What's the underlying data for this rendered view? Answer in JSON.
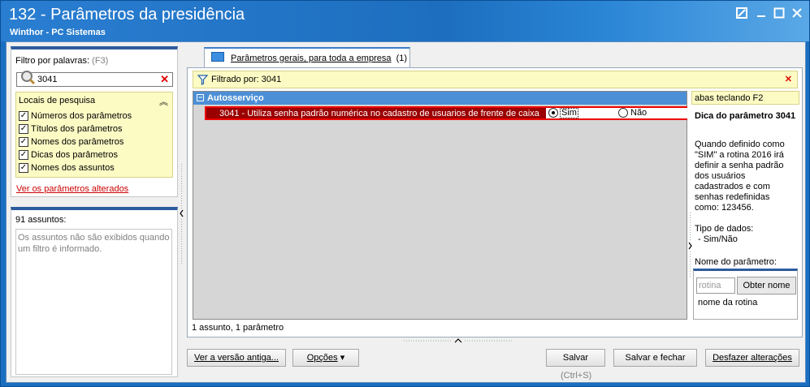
{
  "window": {
    "title": "132 - Parâmetros da presidência",
    "subtitle": "Winthor - PC Sistemas"
  },
  "filter": {
    "label": "Filtro por palavras:",
    "shortcut": "(F3)",
    "search_value": "3041",
    "locais_title": "Locais de pesquisa",
    "options": [
      {
        "label": "Números dos parâmetros",
        "checked": true
      },
      {
        "label": "Títulos dos parâmetros",
        "checked": true
      },
      {
        "label": "Nomes dos parâmetros",
        "checked": true
      },
      {
        "label": "Dicas dos parâmetros",
        "checked": true
      },
      {
        "label": "Nomes dos assuntos",
        "checked": true
      }
    ],
    "altered_link": "Ver os parâmetros alterados"
  },
  "subjects": {
    "count_label": "91 assuntos:",
    "note": "Os assuntos não são exibidos quando um filtro é informado."
  },
  "tab": {
    "label": "Parâmetros gerais, para toda a empresa",
    "count": "(1)"
  },
  "filterbar": {
    "text": "Filtrado por: 3041"
  },
  "grid": {
    "group": "Autosserviço",
    "row_text": "3041 - Utiliza senha padrão numérica no cadastro de usuarios de frente de caixa",
    "opt_yes": "Sim",
    "opt_no": "Não",
    "selected": "Sim",
    "summary": "1 assunto, 1 parâmetro"
  },
  "tip": {
    "hint": "abas teclando F2",
    "heading": "Dica do parâmetro 3041",
    "body": "Quando definido como \"SIM\" a rotina 2016 irá definir a senha padrão dos usuários cadastrados e com senhas redefinidas como: 123456.",
    "type_label": "Tipo de dados:",
    "type_value": "- Sim/Não",
    "name_label": "Nome do parâmetro:",
    "routine_placeholder": "rotina",
    "get_name_button": "Obter nome",
    "routine_name_label": "nome da rotina"
  },
  "buttons": {
    "old_version": "Ver a versão antiga...",
    "options": "Opções",
    "save": "Salvar",
    "save_shortcut": "(Ctrl+S)",
    "save_close": "Salvar e fechar",
    "undo": "Desfazer alterações"
  }
}
